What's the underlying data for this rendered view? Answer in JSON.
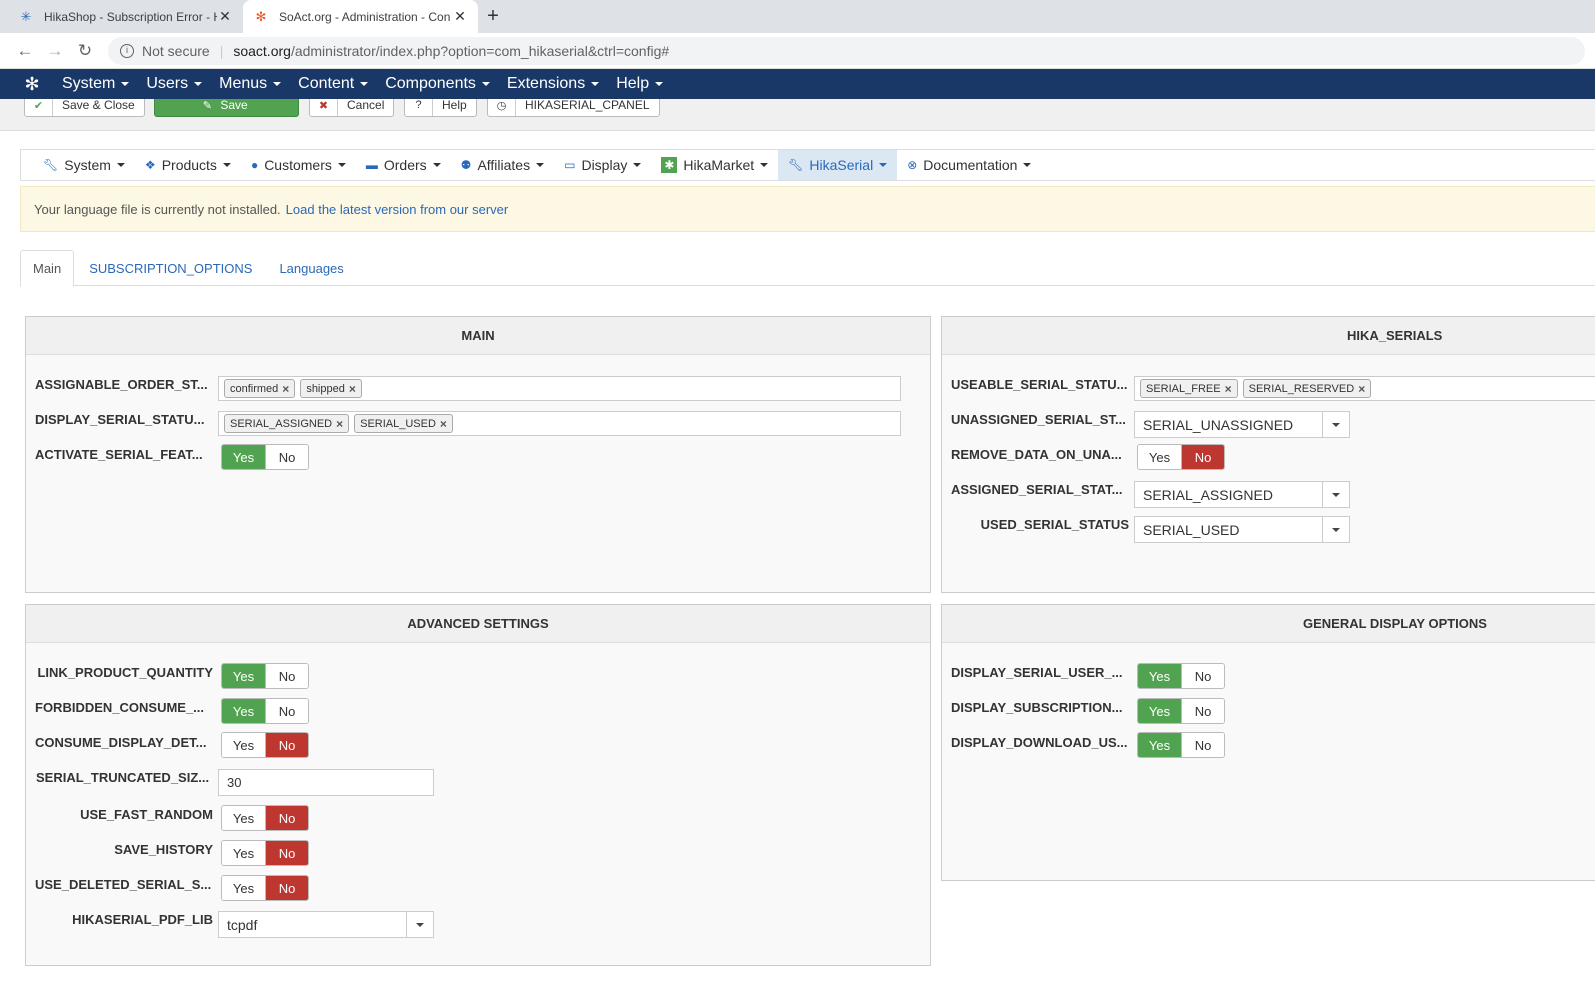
{
  "browser": {
    "tabs": [
      {
        "title": "HikaShop - Subscription Error - H",
        "active": false
      },
      {
        "title": "SoAct.org - Administration - Con",
        "active": true
      }
    ],
    "security": "Not secure",
    "url_host": "soact.org",
    "url_path": "/administrator/index.php?option=com_hikaserial&ctrl=config#"
  },
  "joomla_menu": [
    "System",
    "Users",
    "Menus",
    "Content",
    "Components",
    "Extensions",
    "Help"
  ],
  "toolbar": {
    "save_close": "Save & Close",
    "save": "Save",
    "cancel": "Cancel",
    "help": "Help",
    "cpanel": "HIKASERIAL_CPANEL"
  },
  "component_menu": [
    "System",
    "Products",
    "Customers",
    "Orders",
    "Affiliates",
    "Display",
    "HikaMarket",
    "HikaSerial",
    "Documentation"
  ],
  "notice": {
    "text": "Your language file is currently not installed.",
    "link": "Load the latest version from our server"
  },
  "tabs": [
    "Main",
    "SUBSCRIPTION_OPTIONS",
    "Languages"
  ],
  "toggle_labels": {
    "yes": "Yes",
    "no": "No"
  },
  "main_panel": {
    "title": "MAIN",
    "assignable_label": "ASSIGNABLE_ORDER_ST...",
    "assignable_tags": [
      "confirmed",
      "shipped"
    ],
    "display_label": "DISPLAY_SERIAL_STATU...",
    "display_tags": [
      "SERIAL_ASSIGNED",
      "SERIAL_USED"
    ],
    "activate_label": "ACTIVATE_SERIAL_FEAT...",
    "activate_value": "yes"
  },
  "serials_panel": {
    "title": "HIKA_SERIALS",
    "useable_label": "USEABLE_SERIAL_STATU...",
    "useable_tags": [
      "SERIAL_FREE",
      "SERIAL_RESERVED"
    ],
    "unassigned_label": "UNASSIGNED_SERIAL_ST...",
    "unassigned_value": "SERIAL_UNASSIGNED",
    "remove_label": "REMOVE_DATA_ON_UNA...",
    "remove_value": "no",
    "assigned_label": "ASSIGNED_SERIAL_STAT...",
    "assigned_value": "SERIAL_ASSIGNED",
    "used_label": "USED_SERIAL_STATUS",
    "used_value": "SERIAL_USED"
  },
  "advanced_panel": {
    "title": "ADVANCED SETTINGS",
    "link_label": "LINK_PRODUCT_QUANTITY",
    "link_value": "yes",
    "forbidden_label": "FORBIDDEN_CONSUME_...",
    "forbidden_value": "yes",
    "consume_label": "CONSUME_DISPLAY_DET...",
    "consume_value": "no",
    "truncated_label": "SERIAL_TRUNCATED_SIZ...",
    "truncated_value": "30",
    "fast_random_label": "USE_FAST_RANDOM",
    "fast_random_value": "no",
    "save_history_label": "SAVE_HISTORY",
    "save_history_value": "no",
    "deleted_label": "USE_DELETED_SERIAL_S...",
    "deleted_value": "no",
    "pdf_label": "HIKASERIAL_PDF_LIB",
    "pdf_value": "tcpdf"
  },
  "display_panel": {
    "title": "GENERAL DISPLAY OPTIONS",
    "user_label": "DISPLAY_SERIAL_USER_...",
    "user_value": "yes",
    "subscription_label": "DISPLAY_SUBSCRIPTION...",
    "subscription_value": "yes",
    "download_label": "DISPLAY_DOWNLOAD_US...",
    "download_value": "yes"
  },
  "colors": {
    "joomla_bar": "#1a3867",
    "yes_active": "#51a351",
    "no_active": "#bd362f",
    "link": "#2a69b8",
    "notice_bg": "#fcf8e3"
  }
}
